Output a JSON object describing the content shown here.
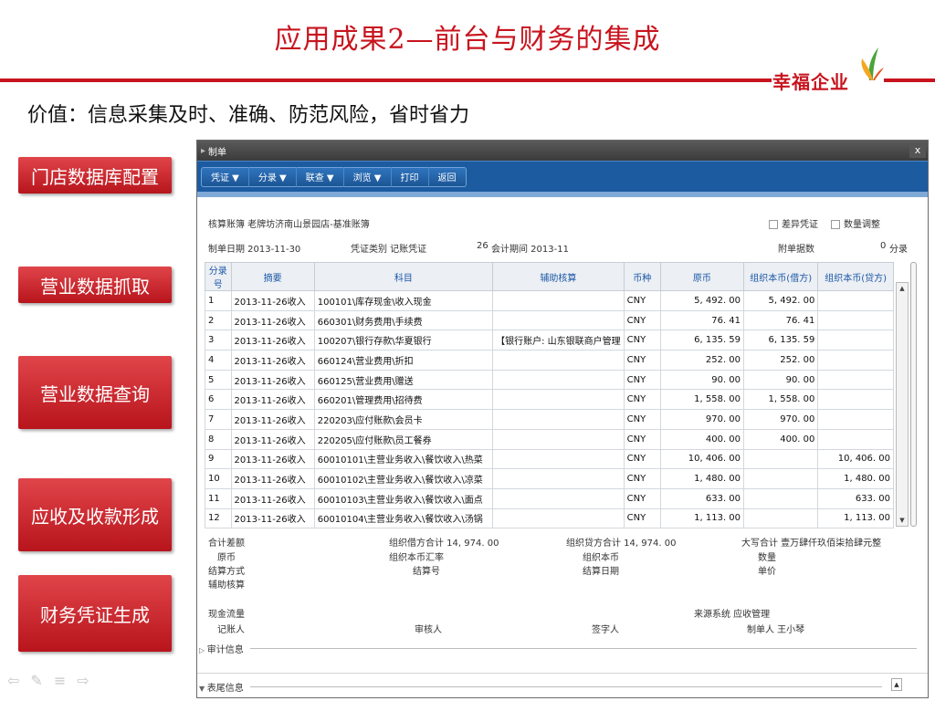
{
  "slide": {
    "title": "应用成果2—前台与财务的集成",
    "subtitle": "价值：信息采集及时、准确、防范风险，省时省力",
    "logo_text": "幸福企业",
    "side_buttons": [
      "门店数据库配置",
      "营业数据抓取",
      "营业数据查询",
      "应收及收款形成",
      "财务凭证生成"
    ],
    "nav_icons": [
      "arrow-left-icon",
      "pen-icon",
      "menu-icon",
      "arrow-right-icon"
    ]
  },
  "window": {
    "title": "制单",
    "close_label": "x",
    "toolbar": [
      {
        "label": "凭证 ▼"
      },
      {
        "label": "分录 ▼"
      },
      {
        "label": "联查 ▼"
      },
      {
        "label": "浏览 ▼"
      },
      {
        "label": "打印"
      },
      {
        "label": "返回"
      }
    ],
    "header": {
      "account_book": "核算账簿  老牌坊济南山景园店-基准账簿",
      "diff_voucher": "差异凭证",
      "qty_adjust": "数量调整",
      "date": "制单日期  2013-11-30",
      "voucher_type": "凭证类别  记账凭证",
      "voucher_no": "26",
      "period": "会计期间  2013-11",
      "attach": "附单据数",
      "attach_count": "0",
      "fenlu": "分录"
    },
    "columns": [
      "分录号",
      "摘要",
      "科目",
      "辅助核算",
      "币种",
      "原币",
      "组织本币(借方)",
      "组织本币(贷方)"
    ],
    "rows": [
      [
        "1",
        "2013-11-26收入",
        "100101\\库存现金\\收入现金",
        "",
        "CNY",
        "5, 492. 00",
        "5, 492. 00",
        ""
      ],
      [
        "2",
        "2013-11-26收入",
        "660301\\财务费用\\手续费",
        "",
        "CNY",
        "76. 41",
        "76. 41",
        ""
      ],
      [
        "3",
        "2013-11-26收入",
        "100207\\银行存款\\华夏银行",
        "【银行账户: 山东银联商户管理",
        "CNY",
        "6, 135. 59",
        "6, 135. 59",
        ""
      ],
      [
        "4",
        "2013-11-26收入",
        "660124\\营业费用\\折扣",
        "",
        "CNY",
        "252. 00",
        "252. 00",
        ""
      ],
      [
        "5",
        "2013-11-26收入",
        "660125\\营业费用\\赠送",
        "",
        "CNY",
        "90. 00",
        "90. 00",
        ""
      ],
      [
        "6",
        "2013-11-26收入",
        "660201\\管理费用\\招待费",
        "",
        "CNY",
        "1, 558. 00",
        "1, 558. 00",
        ""
      ],
      [
        "7",
        "2013-11-26收入",
        "220203\\应付账款\\会员卡",
        "",
        "CNY",
        "970. 00",
        "970. 00",
        ""
      ],
      [
        "8",
        "2013-11-26收入",
        "220205\\应付账款\\员工餐券",
        "",
        "CNY",
        "400. 00",
        "400. 00",
        ""
      ],
      [
        "9",
        "2013-11-26收入",
        "60010101\\主营业务收入\\餐饮收入\\热菜",
        "",
        "CNY",
        "10, 406. 00",
        "",
        "10, 406. 00"
      ],
      [
        "10",
        "2013-11-26收入",
        "60010102\\主营业务收入\\餐饮收入\\凉菜",
        "",
        "CNY",
        "1, 480. 00",
        "",
        "1, 480. 00"
      ],
      [
        "11",
        "2013-11-26收入",
        "60010103\\主营业务收入\\餐饮收入\\面点",
        "",
        "CNY",
        "633. 00",
        "",
        "633. 00"
      ],
      [
        "12",
        "2013-11-26收入",
        "60010104\\主营业务收入\\餐饮收入\\汤锅",
        "",
        "CNY",
        "1, 113. 00",
        "",
        "1, 113. 00"
      ]
    ],
    "summary": {
      "diff": "合计差额",
      "debit_total": "组织借方合计  14, 974. 00",
      "credit_total": "组织贷方合计  14, 974. 00",
      "capital_total": "大写合计  壹万肆仟玖佰柒拾肆元整",
      "orig_currency": "原币",
      "exchange_rate": "组织本币汇率",
      "org_currency": "组织本币",
      "quantity": "数量",
      "settle_method": "结算方式",
      "settle_no": "结算号",
      "settle_date": "结算日期",
      "unit_price": "单价",
      "aux": "辅助核算",
      "cashflow": "现金流量",
      "source": "来源系统  应收管理",
      "bookkeeper": "记账人",
      "auditor": "审核人",
      "signer": "签字人",
      "maker": "制单人  王小琴",
      "audit_info": "审计信息",
      "tail_info": "表尾信息"
    }
  }
}
